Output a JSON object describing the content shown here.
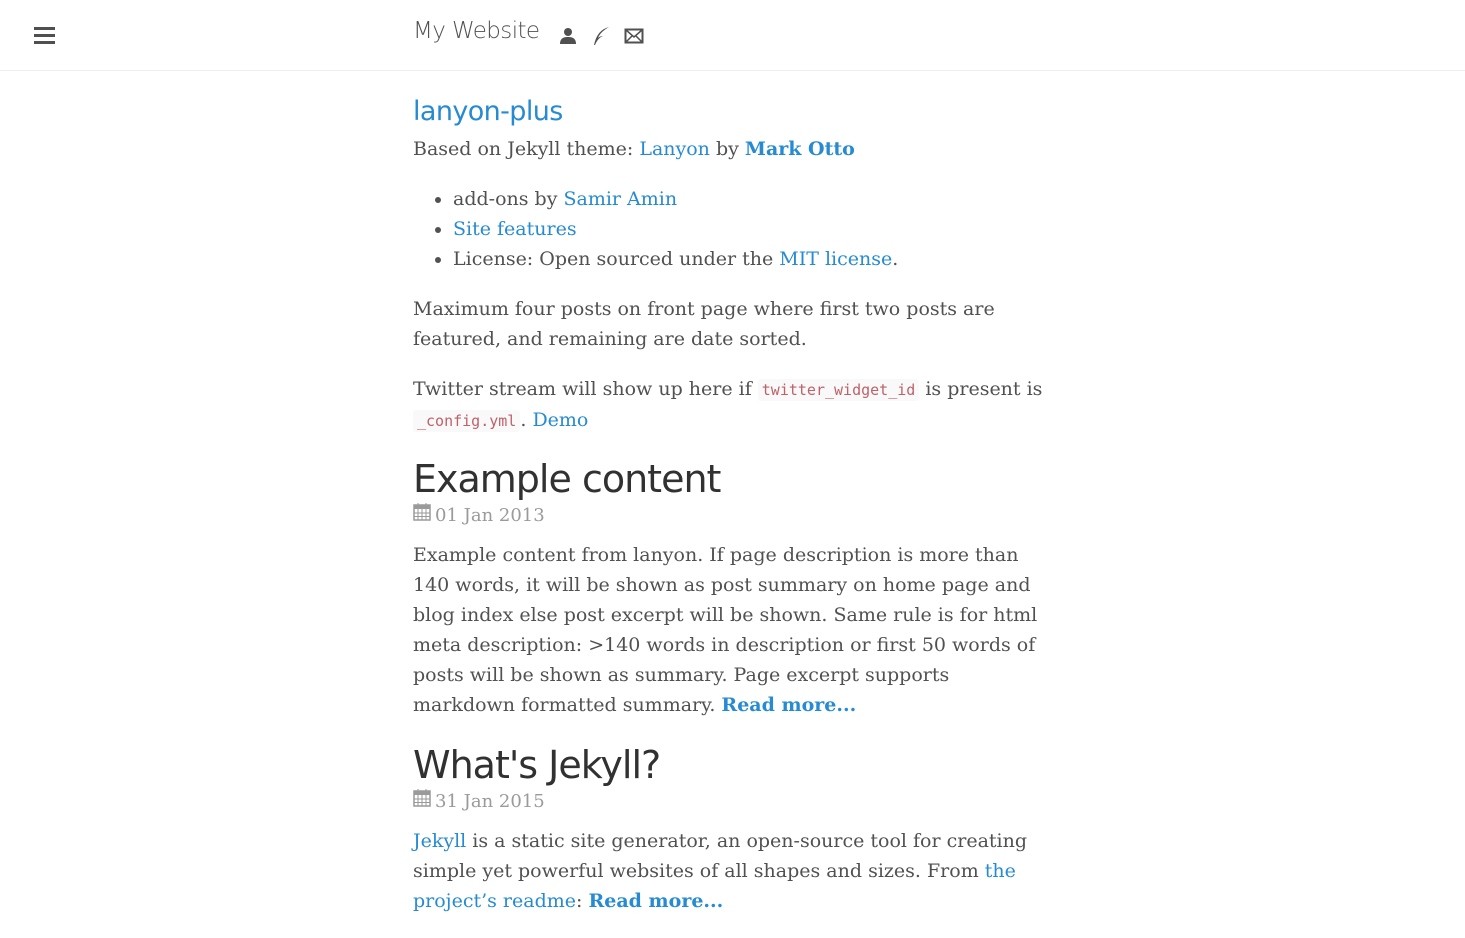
{
  "header": {
    "site_title": "My Website",
    "icons": [
      "user-icon",
      "feather-icon",
      "envelope-icon"
    ]
  },
  "page": {
    "title": "lanyon-plus",
    "intro": {
      "prefix": "Based on Jekyll theme: ",
      "theme_link": "Lanyon",
      "by": " by ",
      "author_link": "Mark Otto"
    },
    "list": {
      "item1_prefix": "add-ons by ",
      "item1_link": "Samir Amin",
      "item2_link": "Site features",
      "item3_prefix": "License: Open sourced under the ",
      "item3_link": "MIT license",
      "item3_suffix": "."
    },
    "para1": "Maximum four posts on front page where first two posts are featured, and remaining are date sorted.",
    "para2": {
      "prefix": "Twitter stream will show up here if ",
      "code1": "twitter_widget_id",
      "middle": " is present is ",
      "code2": "_config.yml",
      "sep": ". ",
      "demo_link": "Demo"
    }
  },
  "posts": [
    {
      "title": "Example content",
      "date": "01 Jan 2013",
      "body": "Example content from lanyon. If page description is more than 140 words, it will be shown as post summary on home page and blog index else post excerpt will be shown. Same rule is for html meta description: >140 words in description or first 50 words of posts will be shown as summary. Page excerpt supports markdown formatted summary. ",
      "read_more": "Read more..."
    },
    {
      "title": "What's Jekyll?",
      "date": "31 Jan 2015",
      "body_link": "Jekyll",
      "body_text": " is a static site generator, an open-source tool for creating simple yet powerful websites of all shapes and sizes. From ",
      "body_link2": "the project’s readme",
      "body_sep": ": ",
      "read_more": "Read more..."
    }
  ],
  "colors": {
    "link": "#268bd2",
    "text": "#515151",
    "heading": "#313131",
    "code": "#bf616a",
    "date": "#9a9a9a"
  }
}
